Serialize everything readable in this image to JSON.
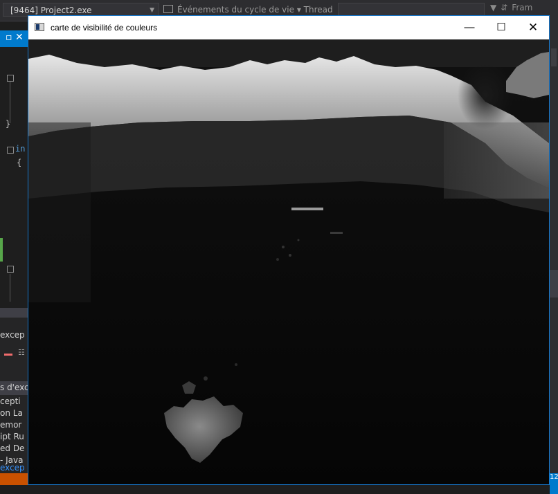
{
  "ide": {
    "process_combo": "[9464] Project2.exe",
    "lifecycle_label": "Événements du cycle de vie ▾ Thread :",
    "right_tools_label": "Fram",
    "tab_close_glyph": "▫ ✕",
    "code_lines": [
      "",
      "}",
      "in",
      "{"
    ],
    "bottom_panel_rows": [
      "excep",
      "",
      "s d'exc",
      "cepti",
      "on La",
      "emor",
      "ipt Ru",
      "ed De",
      "- Java",
      "excep"
    ],
    "right_number": "12"
  },
  "window": {
    "title": "carte de visibilité de couleurs",
    "minimize_glyph": "—",
    "maximize_glyph": "☐",
    "close_glyph": "✕"
  },
  "colors": {
    "accent": "#007acc",
    "window_border": "#1778cc",
    "ide_background": "#1e1e1e"
  }
}
